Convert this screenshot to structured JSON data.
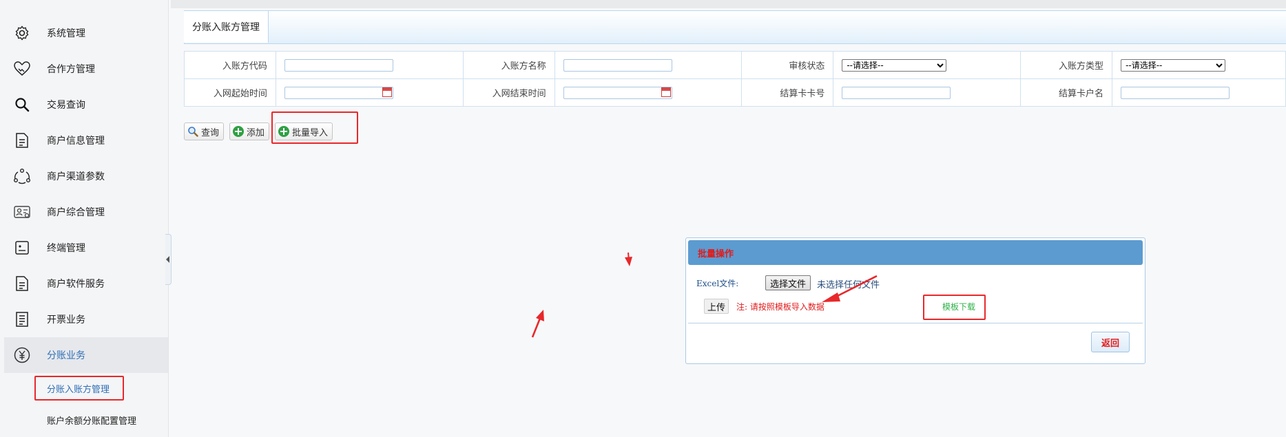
{
  "sidebar": {
    "items": [
      {
        "label": "系统管理",
        "icon": "gear-icon"
      },
      {
        "label": "合作方管理",
        "icon": "handshake-icon"
      },
      {
        "label": "交易查询",
        "icon": "search-icon"
      },
      {
        "label": "商户信息管理",
        "icon": "document-icon"
      },
      {
        "label": "商户渠道参数",
        "icon": "network-icon"
      },
      {
        "label": "商户综合管理",
        "icon": "id-card-icon"
      },
      {
        "label": "终端管理",
        "icon": "terminal-icon"
      },
      {
        "label": "商户软件服务",
        "icon": "document-icon"
      },
      {
        "label": "开票业务",
        "icon": "invoice-icon"
      },
      {
        "label": "分账业务",
        "icon": "yen-circle-icon",
        "active": true
      }
    ],
    "subitems": [
      {
        "label": "分账入账方管理",
        "active": true
      },
      {
        "label": "账户余额分账配置管理"
      }
    ]
  },
  "tab": {
    "label": "分账入账方管理"
  },
  "filters": {
    "row1": {
      "payee_code_label": "入账方代码",
      "payee_name_label": "入账方名称",
      "audit_status_label": "审核状态",
      "audit_status_value": "--请选择--",
      "payee_type_label": "入账方类型",
      "payee_type_value": "--请选择--"
    },
    "row2": {
      "start_time_label": "入网起始时间",
      "end_time_label": "入网结束时间",
      "card_no_label": "结算卡卡号",
      "card_name_label": "结算卡户名"
    }
  },
  "toolbar": {
    "query_label": "查询",
    "add_label": "添加",
    "import_label": "批量导入"
  },
  "modal": {
    "title": "批量操作",
    "excel_label": "Excel文件:",
    "choose_file_label": "选择文件",
    "no_file_text": "未选择任何文件",
    "upload_label": "上传",
    "note": "注: 请按照模板导入数据",
    "template_link": "模板下载",
    "return_label": "返回"
  },
  "colors": {
    "accent_blue": "#2f6fb5",
    "modal_header": "#5b9bd0",
    "annotation_red": "#e8282b",
    "link_green": "#2fb14a"
  }
}
